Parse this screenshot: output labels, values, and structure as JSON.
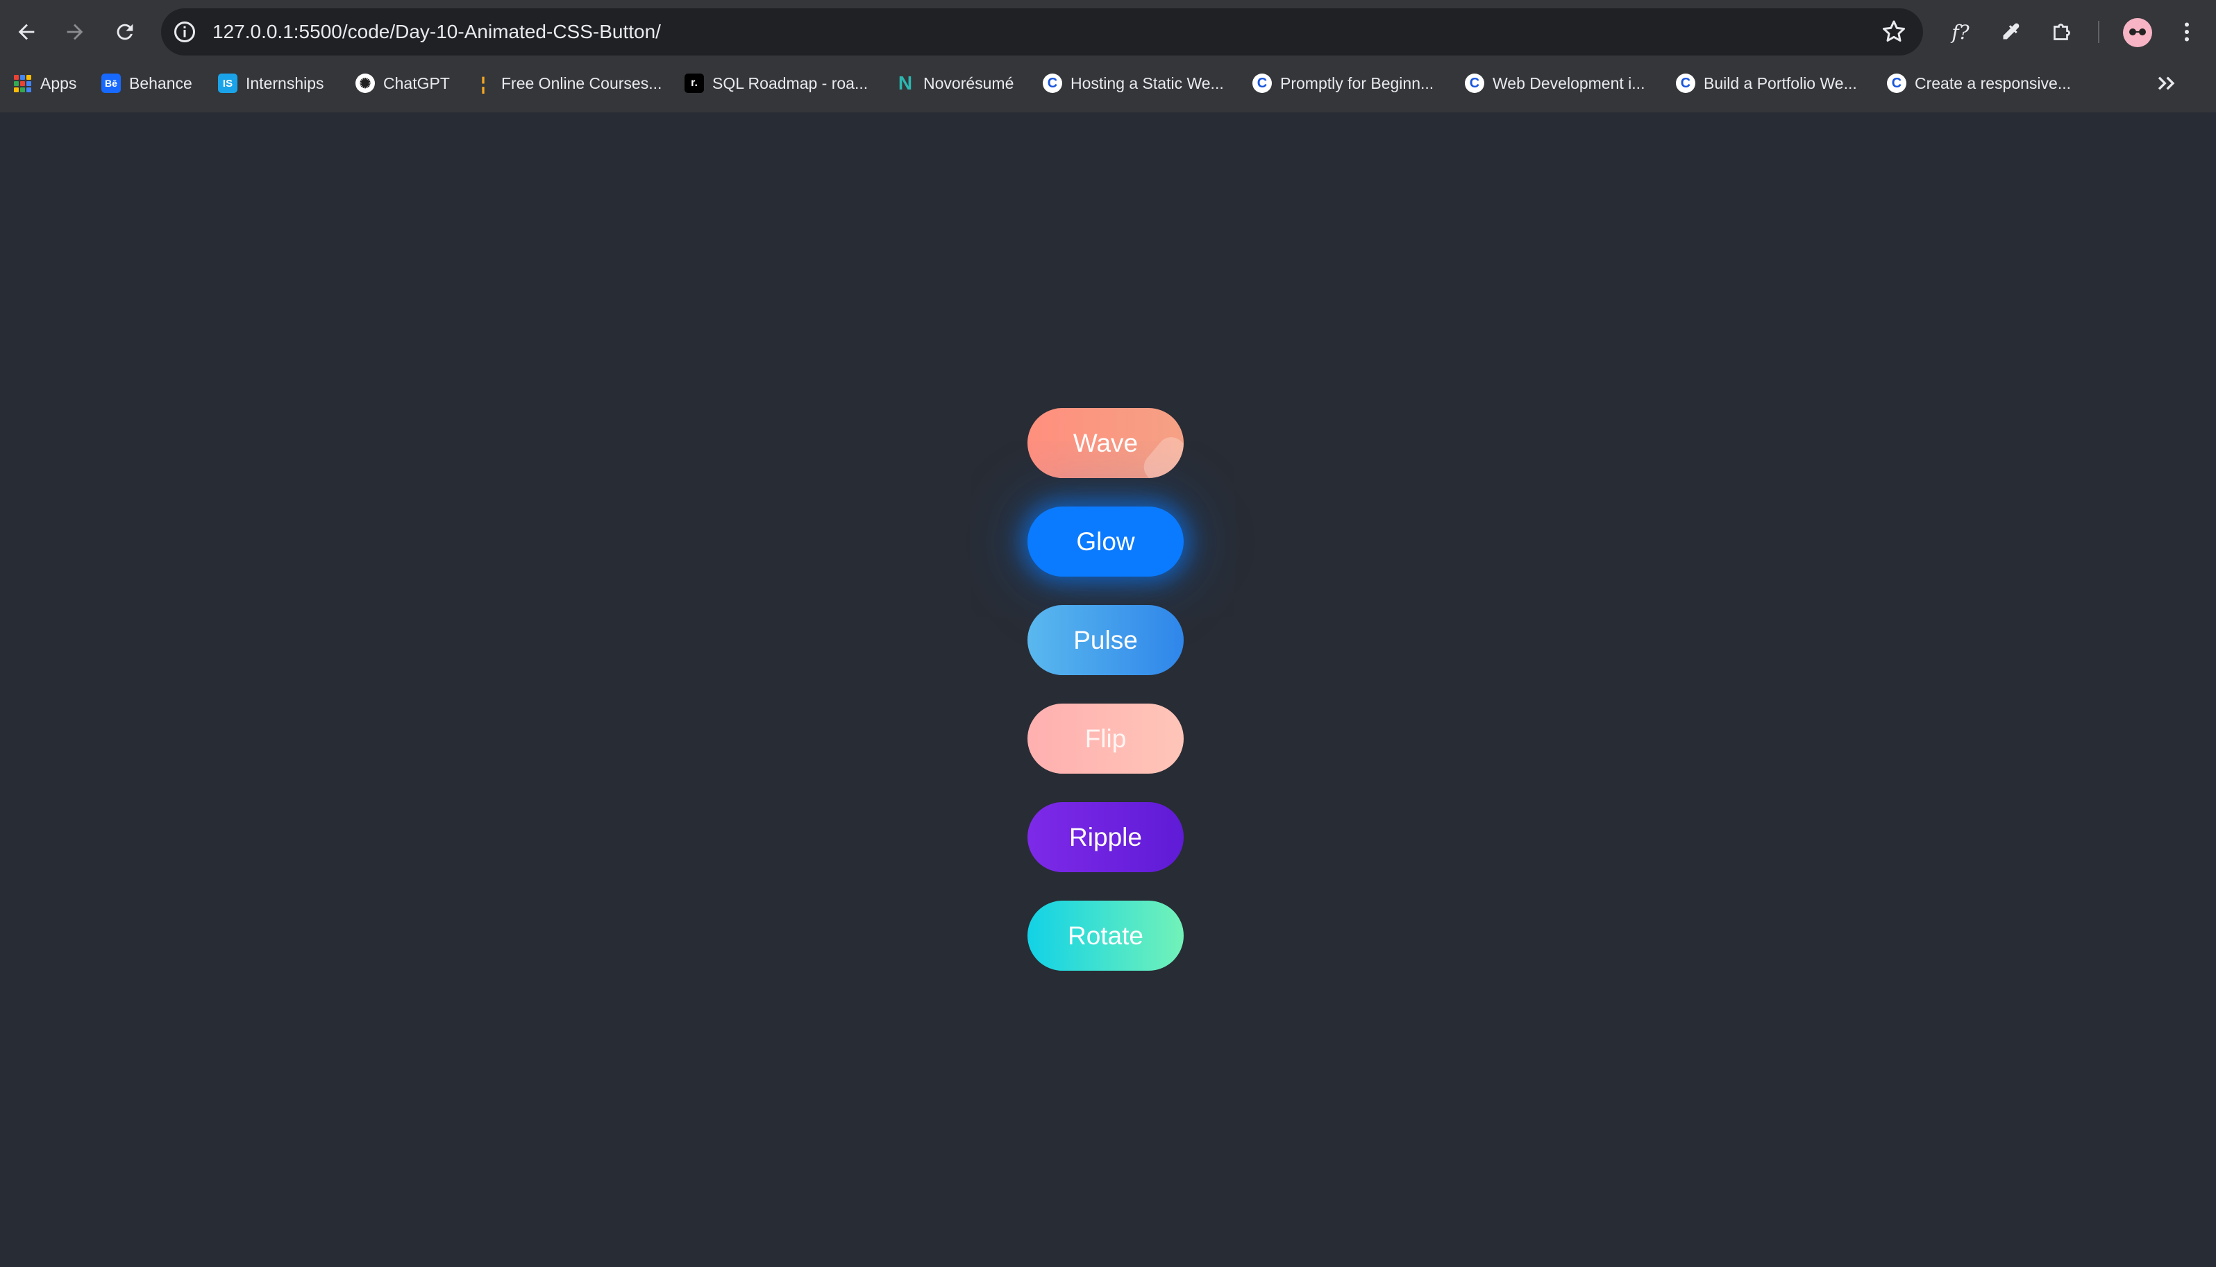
{
  "browser": {
    "url": "127.0.0.1:5500/code/Day-10-Animated-CSS-Button/",
    "bookmarks": [
      {
        "label": "Apps",
        "icon": "apps-grid-icon"
      },
      {
        "label": "Behance",
        "icon": "behance-icon",
        "badge": "Bē",
        "color": "#1769ff"
      },
      {
        "label": "Internships",
        "icon": "internshala-icon",
        "badge": "IS",
        "color": "#1aa3e8"
      },
      {
        "label": "ChatGPT",
        "icon": "chatgpt-icon",
        "badge": "✺",
        "color": "#ffffff"
      },
      {
        "label": "Free Online Courses...",
        "icon": "courses-icon",
        "badge": "¦",
        "color": "#f5a623"
      },
      {
        "label": "SQL Roadmap - roa...",
        "icon": "roadmap-icon",
        "badge": "r.",
        "color": "#000000"
      },
      {
        "label": "Novorésumé",
        "icon": "novoresume-icon",
        "badge": "N",
        "color": "#2bb7b0"
      },
      {
        "label": "Hosting a Static We...",
        "icon": "coursera-icon",
        "badge": "C",
        "color": "#0056d2"
      },
      {
        "label": "Promptly for Beginn...",
        "icon": "coursera-icon",
        "badge": "C",
        "color": "#0056d2"
      },
      {
        "label": "Web Development i...",
        "icon": "coursera-icon",
        "badge": "C",
        "color": "#0056d2"
      },
      {
        "label": "Build a Portfolio We...",
        "icon": "coursera-icon",
        "badge": "C",
        "color": "#0056d2"
      },
      {
        "label": "Create a responsive...",
        "icon": "coursera-icon",
        "badge": "C",
        "color": "#0056d2"
      }
    ]
  },
  "page": {
    "background": "#282c34",
    "buttons": {
      "wave": "Wave",
      "glow": "Glow",
      "pulse": "Pulse",
      "flip": "Flip",
      "ripple": "Ripple",
      "rotate": "Rotate"
    },
    "colors": {
      "wave": "#ff8f7e",
      "glow": "#0a7aff",
      "pulse": "#3a9cec",
      "flip": "#ffb8b2",
      "ripple": "#6c22de",
      "rotate": "#3ee0cf"
    }
  }
}
